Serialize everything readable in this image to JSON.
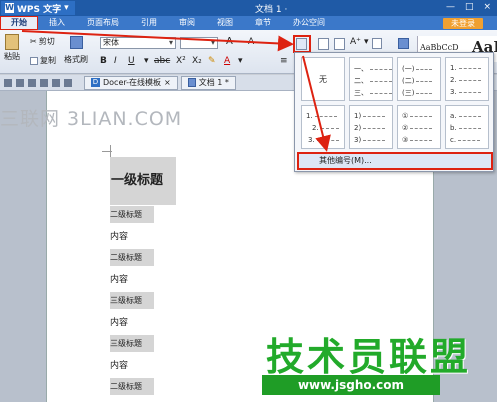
{
  "titlebar": {
    "app_name": "WPS 文字",
    "window_title": "文档 1 ·",
    "controls": [
      "—",
      "□",
      "×"
    ]
  },
  "menu": {
    "tabs": [
      "开始",
      "插入",
      "页面布局",
      "引用",
      "审阅",
      "视图",
      "章节",
      "办公空间"
    ],
    "login_label": "未登录"
  },
  "ribbon": {
    "paste_label": "粘贴",
    "cut_label": "剪切",
    "copy_label": "复制",
    "format_painter_label": "格式刷",
    "font_name": "宋体",
    "style_preview": "AaBbCcD",
    "style_preview_big": "AaB"
  },
  "tabs": {
    "docer": "Docer-在线模板",
    "doc1": "文档 1 *"
  },
  "document": {
    "heading1": "一级标题",
    "rows": [
      {
        "type": "h2",
        "text": "二级标题"
      },
      {
        "type": "body",
        "text": "内容"
      },
      {
        "type": "h2",
        "text": "二级标题"
      },
      {
        "type": "body",
        "text": "内容"
      },
      {
        "type": "h2",
        "text": "三级标题"
      },
      {
        "type": "body",
        "text": "内容"
      },
      {
        "type": "h2",
        "text": "三级标题"
      },
      {
        "type": "body",
        "text": "内容"
      },
      {
        "type": "h2",
        "text": "二级标题"
      }
    ]
  },
  "numbering_panel": {
    "none_label": "无",
    "styles": [
      [
        "一、",
        "二、",
        "三、"
      ],
      [
        "(一)",
        "(二)",
        "(三)"
      ],
      [
        "1.",
        "2.",
        "3."
      ],
      [
        "1.",
        "2.",
        "3."
      ],
      [
        "1)",
        "2)",
        "3)"
      ],
      [
        "①",
        "②",
        "③"
      ],
      [
        "a.",
        "b.",
        "c."
      ]
    ],
    "more_label": "其他编号(M)..."
  },
  "watermarks": {
    "top": "三联网 3LIAN.COM",
    "brand": "技术员联盟",
    "url": "www.jsgho.com"
  }
}
